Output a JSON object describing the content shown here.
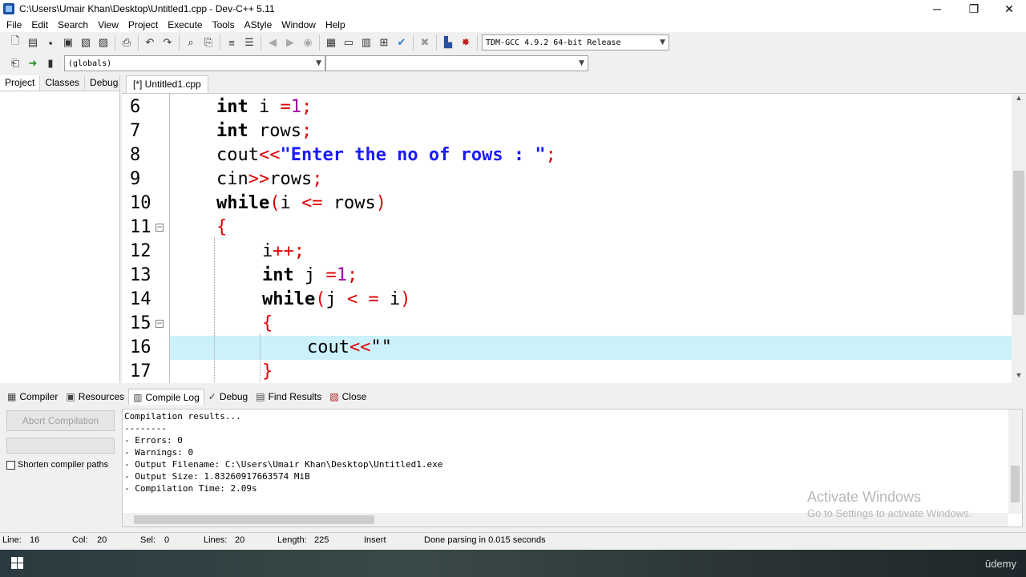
{
  "window": {
    "title": "C:\\Users\\Umair Khan\\Desktop\\Untitled1.cpp - Dev-C++ 5.11",
    "minimize": "─",
    "restore": "❐",
    "close": "✕"
  },
  "menu": [
    "File",
    "Edit",
    "Search",
    "View",
    "Project",
    "Execute",
    "Tools",
    "AStyle",
    "Window",
    "Help"
  ],
  "toolbar": {
    "compiler_select": "TDM-GCC 4.9.2 64-bit Release",
    "scope_select": "(globals)",
    "member_select": ""
  },
  "left_panel": {
    "tabs": [
      "Project",
      "Classes",
      "Debug"
    ],
    "active_tab": "Project"
  },
  "editor": {
    "file_tab": "[*] Untitled1.cpp",
    "lines": [
      {
        "n": "6",
        "tokens": [
          [
            "kw",
            "int"
          ],
          [
            "plain",
            " i "
          ],
          [
            "op",
            "="
          ],
          [
            "num",
            "1"
          ],
          [
            "op",
            ";"
          ]
        ],
        "indent": 1
      },
      {
        "n": "7",
        "tokens": [
          [
            "kw",
            "int"
          ],
          [
            "plain",
            " rows"
          ],
          [
            "op",
            ";"
          ]
        ],
        "indent": 1
      },
      {
        "n": "8",
        "tokens": [
          [
            "plain",
            "cout"
          ],
          [
            "op",
            "<<"
          ],
          [
            "str",
            "\"Enter the no of rows : \""
          ],
          [
            "op",
            ";"
          ]
        ],
        "indent": 1
      },
      {
        "n": "9",
        "tokens": [
          [
            "plain",
            "cin"
          ],
          [
            "op",
            ">>"
          ],
          [
            "plain",
            "rows"
          ],
          [
            "op",
            ";"
          ]
        ],
        "indent": 1
      },
      {
        "n": "10",
        "tokens": [
          [
            "kw",
            "while"
          ],
          [
            "op",
            "("
          ],
          [
            "plain",
            "i "
          ],
          [
            "op",
            "<="
          ],
          [
            "plain",
            " rows"
          ],
          [
            "op",
            ")"
          ]
        ],
        "indent": 1
      },
      {
        "n": "11",
        "tokens": [
          [
            "op",
            "{"
          ]
        ],
        "indent": 1
      },
      {
        "n": "12",
        "tokens": [
          [
            "plain",
            "i"
          ],
          [
            "op",
            "++;"
          ]
        ],
        "indent": 2
      },
      {
        "n": "13",
        "tokens": [
          [
            "kw",
            "int"
          ],
          [
            "plain",
            " j "
          ],
          [
            "op",
            "="
          ],
          [
            "num",
            "1"
          ],
          [
            "op",
            ";"
          ]
        ],
        "indent": 2
      },
      {
        "n": "14",
        "tokens": [
          [
            "kw",
            "while"
          ],
          [
            "op",
            "("
          ],
          [
            "plain",
            "j "
          ],
          [
            "op",
            "<"
          ],
          [
            "plain",
            " "
          ],
          [
            "op",
            "="
          ],
          [
            "plain",
            " i"
          ],
          [
            "op",
            ")"
          ]
        ],
        "indent": 2
      },
      {
        "n": "15",
        "tokens": [
          [
            "op",
            "{"
          ]
        ],
        "indent": 2
      },
      {
        "n": "16",
        "tokens": [
          [
            "plain",
            "cout"
          ],
          [
            "op",
            "<<"
          ],
          [
            "plain",
            "\"\""
          ]
        ],
        "indent": 3
      },
      {
        "n": "17",
        "tokens": [
          [
            "op",
            "}"
          ]
        ],
        "indent": 2
      }
    ],
    "current_line": "16"
  },
  "bottom": {
    "tabs": [
      {
        "label": "Compiler",
        "icon": "▦"
      },
      {
        "label": "Resources",
        "icon": "▣"
      },
      {
        "label": "Compile Log",
        "icon": "▥"
      },
      {
        "label": "Debug",
        "icon": "✓"
      },
      {
        "label": "Find Results",
        "icon": "▤"
      },
      {
        "label": "Close",
        "icon": "▧"
      }
    ],
    "active_tab": "Compile Log",
    "abort_label": "Abort Compilation",
    "shorten_label": "Shorten compiler paths",
    "log": [
      "Compilation results...",
      "--------",
      "- Errors: 0",
      "- Warnings: 0",
      "- Output Filename: C:\\Users\\Umair Khan\\Desktop\\Untitled1.exe",
      "- Output Size: 1.83260917663574 MiB",
      "- Compilation Time: 2.09s"
    ]
  },
  "watermark": {
    "line1": "Activate Windows",
    "line2": "Go to Settings to activate Windows."
  },
  "status": {
    "line_label": "Line:",
    "line_val": "16",
    "col_label": "Col:",
    "col_val": "20",
    "sel_label": "Sel:",
    "sel_val": "0",
    "lines_label": "Lines:",
    "lines_val": "20",
    "length_label": "Length:",
    "length_val": "225",
    "mode": "Insert",
    "message": "Done parsing in 0.015 seconds"
  },
  "taskbar": {
    "brand": "ūdemy"
  }
}
